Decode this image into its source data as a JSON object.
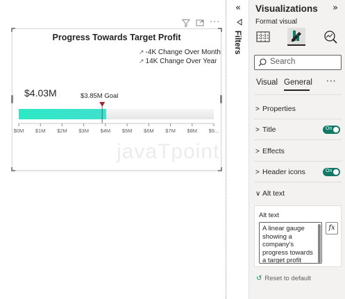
{
  "visual": {
    "header_icons": [
      "filter-icon",
      "focus-mode-icon",
      "more-options-icon"
    ],
    "more_glyph": "···",
    "title": "Progress Towards Target Profit",
    "change_month": "-4K Change Over Month",
    "change_year": "14K Change Over Year",
    "value_label": "$4.03M",
    "goal_label": "$3.85M Goal"
  },
  "chart_data": {
    "type": "bar",
    "orientation": "horizontal-linear-gauge",
    "title": "Progress Towards Target Profit",
    "value": 4.03,
    "value_label": "$4.03M",
    "goal": 3.85,
    "goal_label": "$3.85M Goal",
    "xlim": [
      0,
      9
    ],
    "ticks": [
      "$0M",
      "$1M",
      "$2M",
      "$3M",
      "$4M",
      "$5M",
      "$6M",
      "$7M",
      "$8M",
      "$9..."
    ],
    "tick_values": [
      0,
      1,
      2,
      3,
      4,
      5,
      6,
      7,
      8,
      9
    ],
    "colors": {
      "bar": "#2de8c4",
      "bar_gradient_end": "#41e0cd",
      "track": "#ececec",
      "goal_marker": "#a4262c"
    }
  },
  "watermark": "javaTpoint",
  "filters": {
    "collapse_glyph": "«",
    "icon": "filter-icon",
    "label": "Filters"
  },
  "viz_pane": {
    "title": "Visualizations",
    "expand_glyph": "»",
    "format_label": "Format visual",
    "tools": [
      "build-visual-icon",
      "format-visual-icon",
      "analytics-icon"
    ],
    "search_placeholder": "Search",
    "subtabs": [
      "Visual",
      "General"
    ],
    "active_subtab": "General",
    "more_glyph": "···",
    "sections": {
      "properties": "Properties",
      "title": "Title",
      "effects": "Effects",
      "header_icons": "Header icons",
      "alt_text": "Alt text"
    },
    "toggle_on": "On",
    "alt_text_label": "Alt text",
    "alt_text_value": "A linear gauge showing a company's progress towards a target profit",
    "fx_label": "fx",
    "reset_label": "Reset to default",
    "colors": {
      "accent": "#117865",
      "pane_bg": "#f3f2f1"
    }
  }
}
